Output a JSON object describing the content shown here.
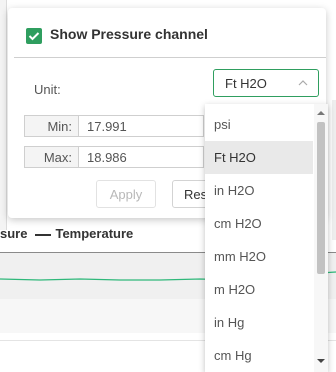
{
  "panel": {
    "show_channel_label": "Show Pressure channel",
    "show_channel_checked": true,
    "unit_label": "Unit:",
    "unit_value": "Ft H2O",
    "min_label": "Min:",
    "min_value": "17.991",
    "max_label": "Max:",
    "max_value": "18.986",
    "apply_label": "Apply",
    "reset_label": "Rese"
  },
  "dropdown": {
    "options": [
      "psi",
      "Ft H2O",
      "in H2O",
      "cm H2O",
      "mm H2O",
      "m H2O",
      "in Hg",
      "cm Hg"
    ],
    "selected": "Ft H2O"
  },
  "background": {
    "legend_partial": "sure",
    "legend_temperature": "Temperature"
  },
  "colors": {
    "accent": "#2f9e5f",
    "temperature_line": "#2fb87a"
  }
}
